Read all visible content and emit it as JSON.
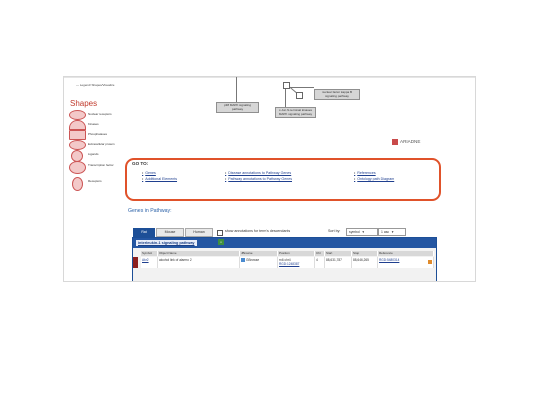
{
  "panel_link": "— Legend/ Shapes/Visualize",
  "shapes": {
    "title": "Shapes",
    "items": [
      {
        "label": "Nuclear receptors",
        "icon": "nuclear-receptor-shape-icon"
      },
      {
        "label": "Kinases",
        "icon": "kinase-shape-icon"
      },
      {
        "label": "Phosphatases",
        "icon": "phosphatase-shape-icon"
      },
      {
        "label": "Extracellular protein",
        "icon": "extracellular-protein-shape-icon"
      },
      {
        "label": "Ligands",
        "icon": "ligand-shape-icon"
      },
      {
        "label": "Transcription factor",
        "icon": "transcription-factor-shape-icon"
      },
      {
        "label": "Receptors",
        "icon": "receptor-shape-icon"
      }
    ]
  },
  "diagram": {
    "nodes": [
      {
        "label": "p38 MAPK signaling pathway"
      },
      {
        "label": "c-Jun N-terminal kinases MAPK signaling pathway"
      },
      {
        "label": "nuclear factor kappa B signaling pathway"
      }
    ]
  },
  "ariadne": "ARIADNE",
  "goto": {
    "title": "GO TO:",
    "links": [
      "Genes",
      "Additional Elements",
      "Disease annotations to Pathway Genes",
      "Pathway annotations to Pathway Genes",
      "References",
      "Ontology path Diagram"
    ]
  },
  "genes": {
    "heading": "Genes in Pathway:",
    "tabs": [
      "Rat",
      "Mouse",
      "Human"
    ],
    "show_annotations_label": "show annotations for term's descendants",
    "sort_label": "Sort by:",
    "sort_field": "symbol",
    "sort_order": "1 asc",
    "table_title": "interleukin-1 signaling pathway",
    "columns": [
      "Symbol",
      "Object Name",
      "JBrowse",
      "Position",
      "Chr",
      "Start",
      "Stop",
      "Reference"
    ],
    "rows": [
      {
        "symbol": "Akr2",
        "object_name": "alcohol link of alarmo 2",
        "jbrowse": "GBrowse",
        "position_1": "rn6 chr4",
        "position_2": "RGD:1248387",
        "chr": "4",
        "start": "88,631,787",
        "stop": "88,646,265",
        "reference": "RGD:5480314"
      }
    ]
  },
  "colors": {
    "accent_red": "#c0392b",
    "header_blue": "#2456a2",
    "goto_border": "#e0522a"
  }
}
